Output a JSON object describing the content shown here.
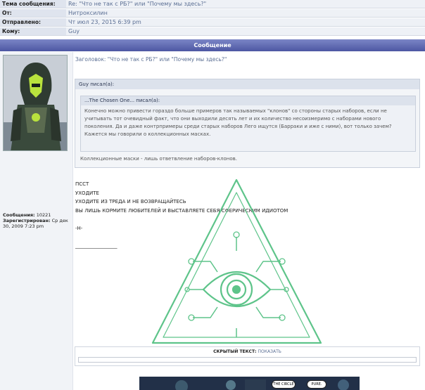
{
  "header": {
    "rows": [
      {
        "label": "Тема сообщения:",
        "value": "Re: \"Что не так с РБ?\" или \"Почему мы здесь?\""
      },
      {
        "label": "От:",
        "value": "Нитроксилин"
      },
      {
        "label": "Отправлено:",
        "value": "Чт июл 23, 2015 6:39 pm"
      },
      {
        "label": "Кому:",
        "value": "Guy"
      }
    ]
  },
  "message_bar": "Сообщение",
  "poster": {
    "posts_label": "Сообщения:",
    "posts_value": "10221",
    "registered_label": "Зарегистрирован:",
    "registered_value": "Ср дек 30, 2009 7:23 pm"
  },
  "post": {
    "subject": "Заголовок: \"Что не так с РБ?\" или \"Почему мы здесь?\"",
    "outer_quote_title": "Guy писал(а):",
    "inner_quote_title": "...The Chosen One... писал(а):",
    "inner_quote_text": "Конечно можно привести гораздо больше примеров так называемых \"клонов\" со стороны старых наборов, если не учитывать тот очевидный факт, что они выходили десять лет и их количество несоизмеримо с наборами нового поколения. Да и даже контрпримеры среди старых наборов Лего ищутся (Барраки и иже с ними), вот только зачем? Кажется мы говорили о коллекционных масках.",
    "outer_quote_text": "Коллекционные маски - лишь ответвление наборов-клонов.",
    "body_lines": [
      "ПССТ",
      "УХОДИТЕ",
      "УХОДИТЕ ИЗ ТРЕДА И НЕ ВОЗВРАЩАЙТЕСЬ",
      "ВЫ ЛИШЬ КОРМИТЕ ЛЮБИТЕЛЕЙ И ВЫСТАВЛЯЕТЕ СЕБЯ СФЕРИЧЕСКИМ ИДИОТОМ",
      "",
      "-Н-",
      "",
      "_________________"
    ]
  },
  "hidden": {
    "label": "СКРЫТЫЙ ТЕКСТ:",
    "show_link": "ПОКАЗАТЬ"
  },
  "comic": {
    "bubble1": "THE CIRCLE",
    "bubble2": "PURE."
  },
  "colors": {
    "accent": "#5b6f94",
    "header_bar": "#5e68b3",
    "eye_green": "#5ec48a"
  }
}
